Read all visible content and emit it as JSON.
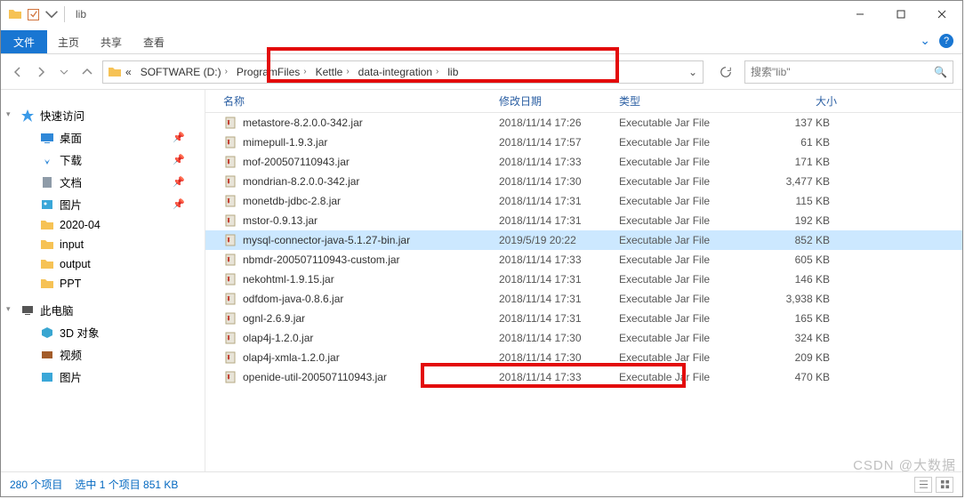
{
  "title": "lib",
  "ribbon_tabs": {
    "file": "文件",
    "home": "主页",
    "share": "共享",
    "view": "查看"
  },
  "breadcrumb": [
    {
      "label": "«"
    },
    {
      "label": "SOFTWARE (D:)"
    },
    {
      "label": "ProgramFiles"
    },
    {
      "label": "Kettle"
    },
    {
      "label": "data-integration"
    },
    {
      "label": "lib"
    }
  ],
  "search_placeholder": "搜索\"lib\"",
  "nav": {
    "quick": {
      "label": "快速访问",
      "items": [
        {
          "label": "桌面",
          "icon": "desktop",
          "pinned": true
        },
        {
          "label": "下载",
          "icon": "downloads",
          "pinned": true
        },
        {
          "label": "文档",
          "icon": "documents",
          "pinned": true
        },
        {
          "label": "图片",
          "icon": "pictures",
          "pinned": true
        },
        {
          "label": "2020-04",
          "icon": "folder",
          "pinned": false
        },
        {
          "label": "input",
          "icon": "folder",
          "pinned": false
        },
        {
          "label": "output",
          "icon": "folder",
          "pinned": false
        },
        {
          "label": "PPT",
          "icon": "folder",
          "pinned": false
        }
      ]
    },
    "thispc": {
      "label": "此电脑",
      "items": [
        {
          "label": "3D 对象",
          "icon": "3d"
        },
        {
          "label": "视频",
          "icon": "videos"
        },
        {
          "label": "图片",
          "icon": "pictures"
        }
      ]
    }
  },
  "columns": {
    "name": "名称",
    "date": "修改日期",
    "type": "类型",
    "size": "大小"
  },
  "files": [
    {
      "name": "metastore-8.2.0.0-342.jar",
      "date": "2018/11/14 17:26",
      "type": "Executable Jar File",
      "size": "137 KB"
    },
    {
      "name": "mimepull-1.9.3.jar",
      "date": "2018/11/14 17:57",
      "type": "Executable Jar File",
      "size": "61 KB"
    },
    {
      "name": "mof-200507110943.jar",
      "date": "2018/11/14 17:33",
      "type": "Executable Jar File",
      "size": "171 KB"
    },
    {
      "name": "mondrian-8.2.0.0-342.jar",
      "date": "2018/11/14 17:30",
      "type": "Executable Jar File",
      "size": "3,477 KB"
    },
    {
      "name": "monetdb-jdbc-2.8.jar",
      "date": "2018/11/14 17:31",
      "type": "Executable Jar File",
      "size": "115 KB"
    },
    {
      "name": "mstor-0.9.13.jar",
      "date": "2018/11/14 17:31",
      "type": "Executable Jar File",
      "size": "192 KB"
    },
    {
      "name": "mysql-connector-java-5.1.27-bin.jar",
      "date": "2019/5/19 20:22",
      "type": "Executable Jar File",
      "size": "852 KB",
      "selected": true
    },
    {
      "name": "nbmdr-200507110943-custom.jar",
      "date": "2018/11/14 17:33",
      "type": "Executable Jar File",
      "size": "605 KB"
    },
    {
      "name": "nekohtml-1.9.15.jar",
      "date": "2018/11/14 17:31",
      "type": "Executable Jar File",
      "size": "146 KB"
    },
    {
      "name": "odfdom-java-0.8.6.jar",
      "date": "2018/11/14 17:31",
      "type": "Executable Jar File",
      "size": "3,938 KB"
    },
    {
      "name": "ognl-2.6.9.jar",
      "date": "2018/11/14 17:31",
      "type": "Executable Jar File",
      "size": "165 KB"
    },
    {
      "name": "olap4j-1.2.0.jar",
      "date": "2018/11/14 17:30",
      "type": "Executable Jar File",
      "size": "324 KB"
    },
    {
      "name": "olap4j-xmla-1.2.0.jar",
      "date": "2018/11/14 17:30",
      "type": "Executable Jar File",
      "size": "209 KB"
    },
    {
      "name": "openide-util-200507110943.jar",
      "date": "2018/11/14 17:33",
      "type": "Executable Jar File",
      "size": "470 KB"
    }
  ],
  "status": {
    "items": "280 个项目",
    "sel": "选中 1 个项目 851 KB"
  },
  "watermark": "CSDN @大数据"
}
